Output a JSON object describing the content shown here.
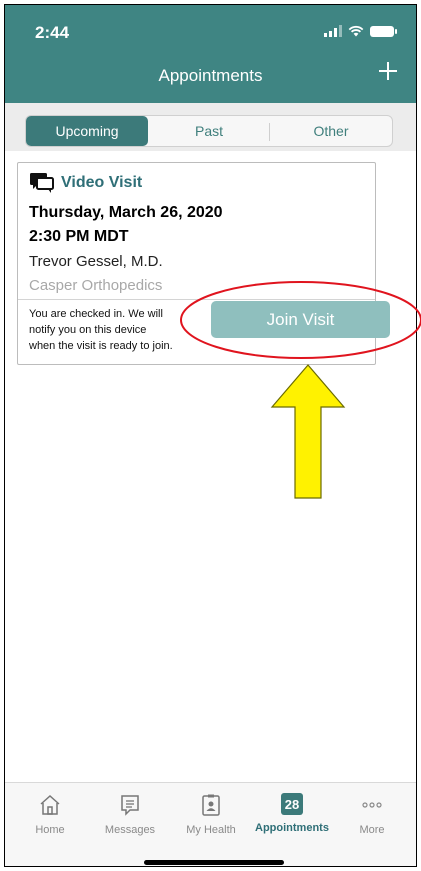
{
  "status_bar": {
    "time": "2:44"
  },
  "header": {
    "title": "Appointments",
    "add_icon": "plus-icon"
  },
  "segments": [
    {
      "label": "Upcoming",
      "active": true
    },
    {
      "label": "Past",
      "active": false
    },
    {
      "label": "Other",
      "active": false
    }
  ],
  "appointment": {
    "type_label": "Video Visit",
    "type_icon": "video-chat-icon",
    "date": "Thursday, March 26, 2020",
    "time": "2:30 PM MDT",
    "provider": "Trevor Gessel, M.D.",
    "department": "Casper Orthopedics",
    "checkin_line1": "You are checked in. We will",
    "checkin_line2": "notify you on this device",
    "checkin_line3": "when the visit is ready to join.",
    "join_label": "Join Visit"
  },
  "tabs": [
    {
      "label": "Home",
      "icon": "home-icon",
      "active": false
    },
    {
      "label": "Messages",
      "icon": "message-icon",
      "active": false
    },
    {
      "label": "My Health",
      "icon": "health-record-icon",
      "active": false
    },
    {
      "label": "Appointments",
      "icon": "calendar-icon",
      "active": true,
      "badge": "28"
    },
    {
      "label": "More",
      "icon": "more-dots-icon",
      "active": false
    }
  ],
  "colors": {
    "header": "#3f8583",
    "segment_active": "#3c7a7a",
    "join_button": "#8fbfbe",
    "annotation_circle": "#e0141e",
    "annotation_arrow_fill": "#fff200"
  }
}
